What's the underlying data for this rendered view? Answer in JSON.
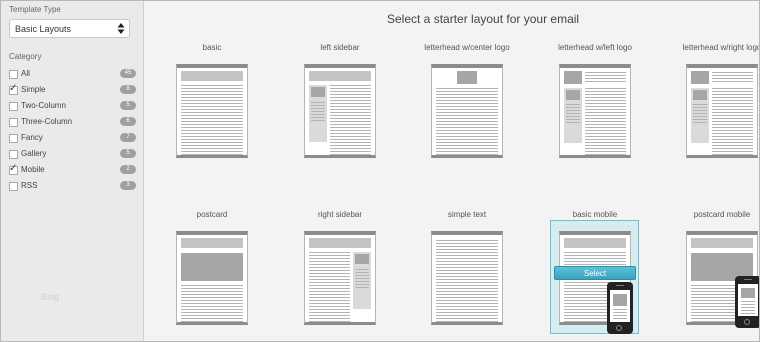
{
  "sidebar": {
    "template_type_label": "Template Type",
    "template_select": {
      "value": "Basic Layouts"
    },
    "category_label": "Category",
    "categories": [
      {
        "label": "All",
        "count": "45",
        "checked": false
      },
      {
        "label": "Simple",
        "count": "8",
        "checked": true
      },
      {
        "label": "Two-Column",
        "count": "5",
        "checked": false
      },
      {
        "label": "Three-Column",
        "count": "6",
        "checked": false
      },
      {
        "label": "Fancy",
        "count": "7",
        "checked": false
      },
      {
        "label": "Gallery",
        "count": "5",
        "checked": false
      },
      {
        "label": "Mobile",
        "count": "2",
        "checked": true
      },
      {
        "label": "RSS",
        "count": "3",
        "checked": false
      }
    ],
    "faded_text": "Blog",
    "check_glyph": "✓"
  },
  "main": {
    "heading": "Select a starter layout for your email",
    "layouts": [
      {
        "label": "basic"
      },
      {
        "label": "left sidebar"
      },
      {
        "label": "letterhead w/center logo"
      },
      {
        "label": "letterhead w/left logo"
      },
      {
        "label": "letterhead w/right logo"
      },
      {
        "label": "postcard"
      },
      {
        "label": "right sidebar"
      },
      {
        "label": "simple text"
      },
      {
        "label": "basic mobile",
        "selected": true
      },
      {
        "label": "postcard mobile"
      }
    ],
    "select_button_label": "Select"
  },
  "colors": {
    "accent": "#3aa3bd",
    "selected_bg": "#d7ecf1"
  }
}
